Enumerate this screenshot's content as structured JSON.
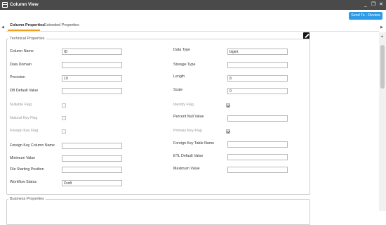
{
  "window": {
    "title": "Column View",
    "controls": {
      "minimize": "_",
      "restore": "❐",
      "close": "✕"
    }
  },
  "toolbar": {
    "send_to_review": "Send To - Review"
  },
  "tabs": [
    {
      "label": "Column Properties",
      "active": true
    },
    {
      "label": "Extended Properties",
      "active": false
    }
  ],
  "technical": {
    "legend": "Technical Properties",
    "column_name": {
      "label": "Column Name",
      "value": "ID"
    },
    "data_type": {
      "label": "Data Type",
      "value": "bigint"
    },
    "data_domain": {
      "label": "Data Domain",
      "value": ""
    },
    "storage_type": {
      "label": "Storage Type",
      "value": ""
    },
    "precision": {
      "label": "Precision",
      "value": "19"
    },
    "length": {
      "label": "Length",
      "value": "8"
    },
    "db_default_value": {
      "label": "DB Default Value",
      "value": ""
    },
    "scale": {
      "label": "Scale",
      "value": "0"
    },
    "nullable_flag": {
      "label": "Nullable Flag",
      "checked": false
    },
    "identity_flag": {
      "label": "Identity Flag",
      "checked": true
    },
    "natural_key_flag": {
      "label": "Natural Key Flag",
      "checked": false
    },
    "percent_null_value": {
      "label": "Percent Null Value",
      "value": ""
    },
    "foreign_key_flag": {
      "label": "Foreign Key Flag",
      "checked": false
    },
    "primary_key_flag": {
      "label": "Primary Key Flag",
      "checked": true
    },
    "foreign_key_column_name": {
      "label": "Foreign Key Column Name",
      "value": ""
    },
    "foreign_key_table_name": {
      "label": "Foreign Key Table Name",
      "value": ""
    },
    "minimum_value": {
      "label": "Minimum Value",
      "value": ""
    },
    "etl_default_value": {
      "label": "ETL Default Value",
      "value": ""
    },
    "file_starting_position": {
      "label": "File Starting Position",
      "value": ""
    },
    "maximum_value": {
      "label": "Maximum Value",
      "value": ""
    },
    "workflow_status": {
      "label": "Workflow Status",
      "value": "Draft"
    }
  },
  "business": {
    "legend": "Business Properties"
  },
  "colors": {
    "titlebar": "#4a4a4a",
    "accent_button": "#2d9ce8",
    "tab_underline": "#f0a020"
  }
}
